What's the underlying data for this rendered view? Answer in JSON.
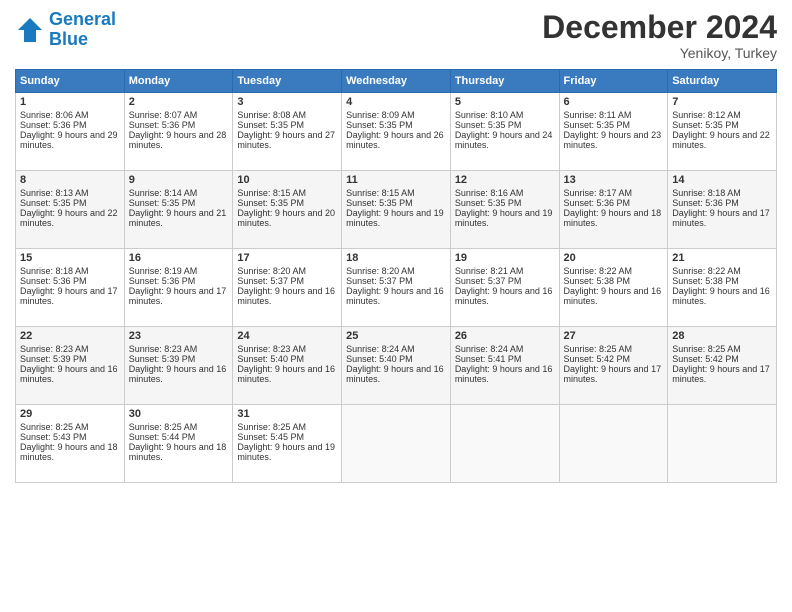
{
  "header": {
    "logo_line1": "General",
    "logo_line2": "Blue",
    "month": "December 2024",
    "location": "Yenikoy, Turkey"
  },
  "days_of_week": [
    "Sunday",
    "Monday",
    "Tuesday",
    "Wednesday",
    "Thursday",
    "Friday",
    "Saturday"
  ],
  "weeks": [
    [
      {
        "day": 1,
        "sunrise": "8:06 AM",
        "sunset": "5:36 PM",
        "daylight": "9 hours and 29 minutes."
      },
      {
        "day": 2,
        "sunrise": "8:07 AM",
        "sunset": "5:36 PM",
        "daylight": "9 hours and 28 minutes."
      },
      {
        "day": 3,
        "sunrise": "8:08 AM",
        "sunset": "5:35 PM",
        "daylight": "9 hours and 27 minutes."
      },
      {
        "day": 4,
        "sunrise": "8:09 AM",
        "sunset": "5:35 PM",
        "daylight": "9 hours and 26 minutes."
      },
      {
        "day": 5,
        "sunrise": "8:10 AM",
        "sunset": "5:35 PM",
        "daylight": "9 hours and 24 minutes."
      },
      {
        "day": 6,
        "sunrise": "8:11 AM",
        "sunset": "5:35 PM",
        "daylight": "9 hours and 23 minutes."
      },
      {
        "day": 7,
        "sunrise": "8:12 AM",
        "sunset": "5:35 PM",
        "daylight": "9 hours and 22 minutes."
      }
    ],
    [
      {
        "day": 8,
        "sunrise": "8:13 AM",
        "sunset": "5:35 PM",
        "daylight": "9 hours and 22 minutes."
      },
      {
        "day": 9,
        "sunrise": "8:14 AM",
        "sunset": "5:35 PM",
        "daylight": "9 hours and 21 minutes."
      },
      {
        "day": 10,
        "sunrise": "8:15 AM",
        "sunset": "5:35 PM",
        "daylight": "9 hours and 20 minutes."
      },
      {
        "day": 11,
        "sunrise": "8:15 AM",
        "sunset": "5:35 PM",
        "daylight": "9 hours and 19 minutes."
      },
      {
        "day": 12,
        "sunrise": "8:16 AM",
        "sunset": "5:35 PM",
        "daylight": "9 hours and 19 minutes."
      },
      {
        "day": 13,
        "sunrise": "8:17 AM",
        "sunset": "5:36 PM",
        "daylight": "9 hours and 18 minutes."
      },
      {
        "day": 14,
        "sunrise": "8:18 AM",
        "sunset": "5:36 PM",
        "daylight": "9 hours and 17 minutes."
      }
    ],
    [
      {
        "day": 15,
        "sunrise": "8:18 AM",
        "sunset": "5:36 PM",
        "daylight": "9 hours and 17 minutes."
      },
      {
        "day": 16,
        "sunrise": "8:19 AM",
        "sunset": "5:36 PM",
        "daylight": "9 hours and 17 minutes."
      },
      {
        "day": 17,
        "sunrise": "8:20 AM",
        "sunset": "5:37 PM",
        "daylight": "9 hours and 16 minutes."
      },
      {
        "day": 18,
        "sunrise": "8:20 AM",
        "sunset": "5:37 PM",
        "daylight": "9 hours and 16 minutes."
      },
      {
        "day": 19,
        "sunrise": "8:21 AM",
        "sunset": "5:37 PM",
        "daylight": "9 hours and 16 minutes."
      },
      {
        "day": 20,
        "sunrise": "8:22 AM",
        "sunset": "5:38 PM",
        "daylight": "9 hours and 16 minutes."
      },
      {
        "day": 21,
        "sunrise": "8:22 AM",
        "sunset": "5:38 PM",
        "daylight": "9 hours and 16 minutes."
      }
    ],
    [
      {
        "day": 22,
        "sunrise": "8:23 AM",
        "sunset": "5:39 PM",
        "daylight": "9 hours and 16 minutes."
      },
      {
        "day": 23,
        "sunrise": "8:23 AM",
        "sunset": "5:39 PM",
        "daylight": "9 hours and 16 minutes."
      },
      {
        "day": 24,
        "sunrise": "8:23 AM",
        "sunset": "5:40 PM",
        "daylight": "9 hours and 16 minutes."
      },
      {
        "day": 25,
        "sunrise": "8:24 AM",
        "sunset": "5:40 PM",
        "daylight": "9 hours and 16 minutes."
      },
      {
        "day": 26,
        "sunrise": "8:24 AM",
        "sunset": "5:41 PM",
        "daylight": "9 hours and 16 minutes."
      },
      {
        "day": 27,
        "sunrise": "8:25 AM",
        "sunset": "5:42 PM",
        "daylight": "9 hours and 17 minutes."
      },
      {
        "day": 28,
        "sunrise": "8:25 AM",
        "sunset": "5:42 PM",
        "daylight": "9 hours and 17 minutes."
      }
    ],
    [
      {
        "day": 29,
        "sunrise": "8:25 AM",
        "sunset": "5:43 PM",
        "daylight": "9 hours and 18 minutes."
      },
      {
        "day": 30,
        "sunrise": "8:25 AM",
        "sunset": "5:44 PM",
        "daylight": "9 hours and 18 minutes."
      },
      {
        "day": 31,
        "sunrise": "8:25 AM",
        "sunset": "5:45 PM",
        "daylight": "9 hours and 19 minutes."
      },
      null,
      null,
      null,
      null
    ]
  ]
}
